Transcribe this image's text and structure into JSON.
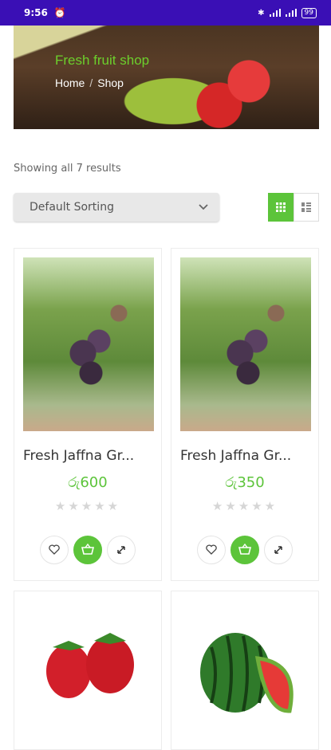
{
  "status_bar": {
    "time": "9:56",
    "battery": "99"
  },
  "hero": {
    "title": "Fresh fruit shop",
    "crumb_home": "Home",
    "crumb_sep": "/",
    "crumb_shop": "Shop"
  },
  "results_text": "Showing all 7 results",
  "sort": {
    "selected": "Default Sorting"
  },
  "products": [
    {
      "name": "Fresh Jaffna Gr...",
      "price": "රු600",
      "stars": "★★★★★",
      "rating": 0
    },
    {
      "name": "Fresh Jaffna Gr...",
      "price": "රු350",
      "stars": "★★★★★",
      "rating": 0
    }
  ],
  "colors": {
    "accent": "#5cc43a",
    "status_bar": "#3a0fb5"
  }
}
